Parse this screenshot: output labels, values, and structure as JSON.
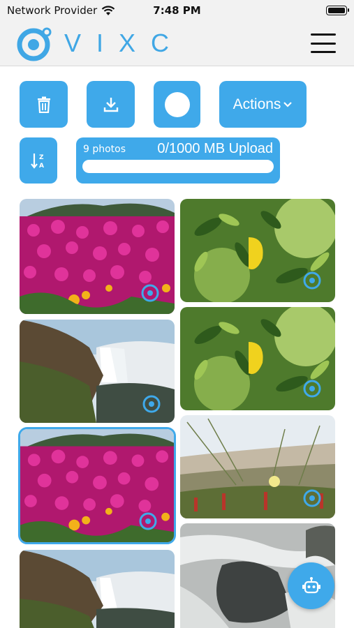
{
  "status_bar": {
    "carrier": "Network Provider",
    "time": "7:48 PM"
  },
  "header": {
    "logo_text": "VIXC"
  },
  "toolbar": {
    "actions_label": "Actions"
  },
  "upload": {
    "count_label": "9 photos",
    "status_label": "0/1000 MB Upload",
    "progress_fraction": 0
  },
  "photos": [
    {
      "name": "flowers-1",
      "selected": false
    },
    {
      "name": "waterfall-1",
      "selected": false
    },
    {
      "name": "flowers-2",
      "selected": true
    },
    {
      "name": "waterfall-2",
      "selected": false
    },
    {
      "name": "leaves-1",
      "selected": false
    },
    {
      "name": "leaves-2",
      "selected": false
    },
    {
      "name": "dunes",
      "selected": false
    },
    {
      "name": "river-rock",
      "selected": false
    }
  ],
  "colors": {
    "accent": "#3fa9ea",
    "header_bg": "#f2f2f2"
  },
  "icons": [
    "wifi-icon",
    "battery-icon",
    "trash-icon",
    "download-icon",
    "sort-az-icon",
    "chevron-down-icon",
    "menu-icon",
    "sync-icon",
    "bot-icon"
  ]
}
